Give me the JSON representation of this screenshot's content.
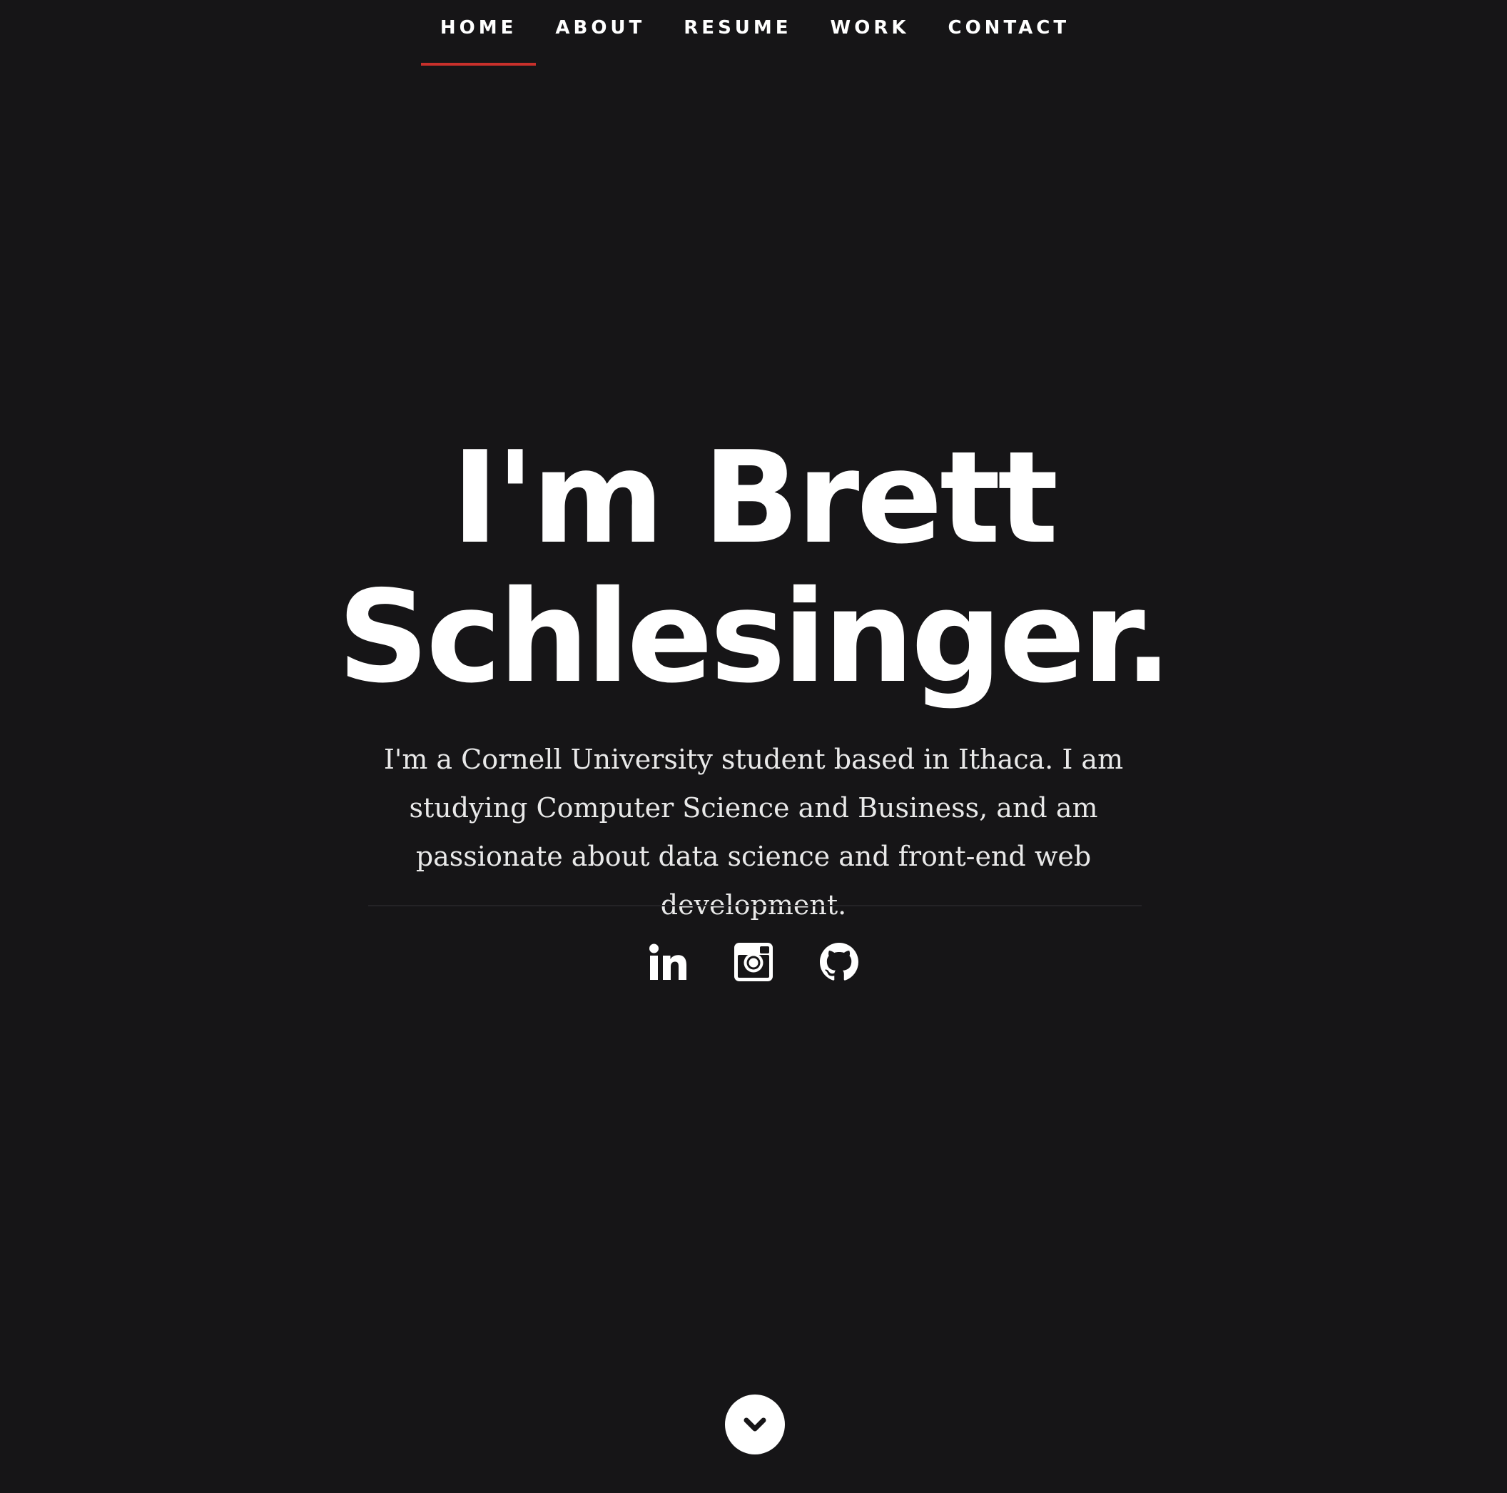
{
  "nav": {
    "items": [
      {
        "label": "HOME",
        "active": true
      },
      {
        "label": "ABOUT",
        "active": false
      },
      {
        "label": "RESUME",
        "active": false
      },
      {
        "label": "WORK",
        "active": false
      },
      {
        "label": "CONTACT",
        "active": false
      }
    ],
    "active_underline_color": "#c8302b"
  },
  "hero": {
    "headline_line1": "I'm Brett",
    "headline_line2": "Schlesinger.",
    "intro": "I'm a Cornell University student based in Ithaca. I am studying Computer Science and Business, and am passionate about data science and front-end web development."
  },
  "social": [
    {
      "icon": "linkedin-icon"
    },
    {
      "icon": "instagram-icon"
    },
    {
      "icon": "github-icon"
    }
  ],
  "scroll_button": {
    "icon": "chevron-down-icon"
  },
  "colors": {
    "background": "#161517",
    "text": "#ffffff",
    "accent": "#c8302b"
  }
}
